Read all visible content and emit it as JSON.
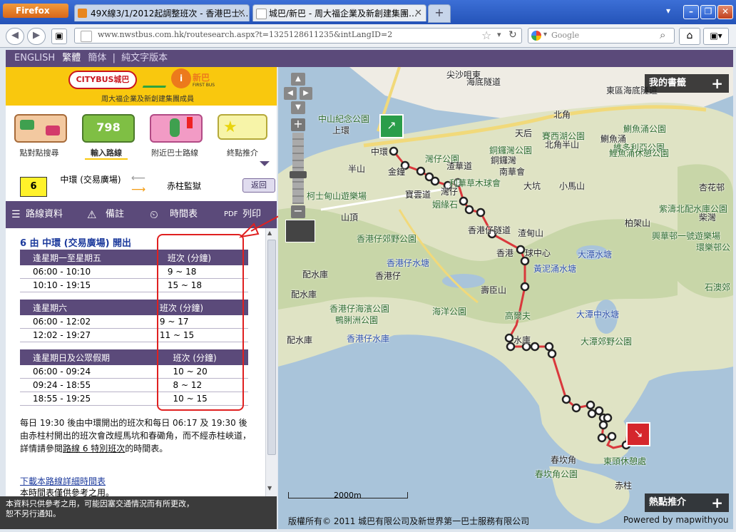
{
  "browser": {
    "app_button": "Firefox",
    "tabs": [
      {
        "title": "49X線3/1/2012起調整班次 - 香港巴士…",
        "active": false
      },
      {
        "title": "城巴/新巴 - 周大福企業及新創建集團…",
        "active": true
      }
    ],
    "new_tab": "+",
    "url": "www.nwstbus.com.hk/routesearch.aspx?t=1325128611235&intLangID=2",
    "search_engine": "Google",
    "search_placeholder": "Google"
  },
  "langbar": {
    "english": "ENGLISH",
    "traditional": "繁體",
    "simplified": "簡体",
    "sep": "|",
    "text_only": "純文字版本"
  },
  "header": {
    "citybus": "CITYBUS城巴",
    "firstbus": "新巴",
    "firstbus_en": "FIRST BUS",
    "tagline": "周大福企業及新創建集團成員"
  },
  "nav_icons": [
    {
      "label": "點對點搜尋"
    },
    {
      "label": "輸入路線"
    },
    {
      "label": "附近巴士路線"
    },
    {
      "label": "終點推介"
    }
  ],
  "route": {
    "number": "6",
    "from": "中環 (交易廣場)",
    "to": "赤柱監獄",
    "back": "返回"
  },
  "subtabs": {
    "info": "路線資料",
    "notes": "備註",
    "timetable": "時間表",
    "print": "列印"
  },
  "schedule": {
    "heading": "6 由 中環 (交易廣場) 開出",
    "freq_header": "班次 (分鐘)",
    "groups": [
      {
        "label": "逢星期一至星期五",
        "rows": [
          [
            "06:00 - 10:10",
            "9 ~ 18"
          ],
          [
            "10:10 - 19:15",
            "15 ~ 18"
          ]
        ]
      },
      {
        "label": "逢星期六",
        "rows": [
          [
            "06:00 - 12:02",
            "9 ~ 17"
          ],
          [
            "12:02 - 19:27",
            "11 ~ 15"
          ]
        ]
      },
      {
        "label": "逢星期日及公眾假期",
        "rows": [
          [
            "06:00 - 09:24",
            "10 ~ 20"
          ],
          [
            "09:24 - 18:55",
            "8 ~ 12"
          ],
          [
            "18:55 - 19:25",
            "10 ~ 15"
          ]
        ]
      }
    ],
    "note_pre": "每日 19:30 後由中環開出的班次和每日 06:17 及 19:30 後由赤柱村開出的班次會改經馬坑和春磡角，而不經赤柱峽道，詳情請參閱",
    "note_link": "路線 6 特別班次",
    "note_post": "的時間表。",
    "download_link": "下載本路線詳細時間表",
    "download_note": "本時間表僅供參考之用。"
  },
  "footer": {
    "line1": "本資料只供參考之用，可能因塞交通情況而有所更改，",
    "line2": "恕不另行通知。"
  },
  "map": {
    "bookmarks": "我的書籤",
    "recommend": "熱點推介",
    "scale": "2000m",
    "copyright": "版權所有© 2011 城巴有限公司及新世界第一巴士服務有限公司",
    "powered": "Powered by mapwithyou",
    "labels": [
      {
        "text": "尖沙咀東",
        "cls": ""
      },
      {
        "text": "海底隧道",
        "cls": ""
      },
      {
        "text": "東區海底隧道",
        "cls": ""
      },
      {
        "text": "北角",
        "cls": ""
      },
      {
        "text": "中山紀念公園",
        "cls": "green"
      },
      {
        "text": "上環",
        "cls": ""
      },
      {
        "text": "天后",
        "cls": ""
      },
      {
        "text": "賽西湖公園",
        "cls": "green"
      },
      {
        "text": "鰂魚涌",
        "cls": ""
      },
      {
        "text": "鰂魚涌公園",
        "cls": "green"
      },
      {
        "text": "北角半山",
        "cls": ""
      },
      {
        "text": "中環",
        "cls": ""
      },
      {
        "text": "維多利亞公園",
        "cls": "green"
      },
      {
        "text": "銅鑼灣公園",
        "cls": "green"
      },
      {
        "text": "鯉魚涌休憩公園",
        "cls": "green"
      },
      {
        "text": "半山",
        "cls": ""
      },
      {
        "text": "金鐘",
        "cls": ""
      },
      {
        "text": "灣仔公園",
        "cls": "green"
      },
      {
        "text": "銅鑼灣",
        "cls": ""
      },
      {
        "text": "南華會",
        "cls": ""
      },
      {
        "text": "渣華道",
        "cls": ""
      },
      {
        "text": "利華草木球會",
        "cls": "green"
      },
      {
        "text": "灣仔",
        "cls": ""
      },
      {
        "text": "寶雲道",
        "cls": ""
      },
      {
        "text": "大坑",
        "cls": ""
      },
      {
        "text": "小馬山",
        "cls": ""
      },
      {
        "text": "柏架山",
        "cls": ""
      },
      {
        "text": "杏花邨",
        "cls": ""
      },
      {
        "text": "柯士甸山遊樂場",
        "cls": "green"
      },
      {
        "text": "姻緣石",
        "cls": "green"
      },
      {
        "text": "紫濤北配水庫公園",
        "cls": "green"
      },
      {
        "text": "柴灣",
        "cls": ""
      },
      {
        "text": "山頂",
        "cls": ""
      },
      {
        "text": "香港仔隧道",
        "cls": ""
      },
      {
        "text": "渣甸山",
        "cls": ""
      },
      {
        "text": "興華邨一號遊樂場",
        "cls": "green"
      },
      {
        "text": "香港仔郊野公園",
        "cls": "green"
      },
      {
        "text": "香港",
        "cls": ""
      },
      {
        "text": "球中心",
        "cls": ""
      },
      {
        "text": "大潭水塘",
        "cls": "blue"
      },
      {
        "text": "環樂邨公",
        "cls": "green"
      },
      {
        "text": "配水庫",
        "cls": ""
      },
      {
        "text": "香港仔水塘",
        "cls": "blue"
      },
      {
        "text": "香港仔",
        "cls": ""
      },
      {
        "text": "黃泥涌水塘",
        "cls": "blue"
      },
      {
        "text": "石澳郊",
        "cls": "green"
      },
      {
        "text": "壽臣山",
        "cls": ""
      },
      {
        "text": "配水庫",
        "cls": ""
      },
      {
        "text": "香港仔海濱公園",
        "cls": "green"
      },
      {
        "text": "海洋公園",
        "cls": "green"
      },
      {
        "text": "高爾夫",
        "cls": "green"
      },
      {
        "text": "大潭中水塘",
        "cls": "blue"
      },
      {
        "text": "鴨脷洲公園",
        "cls": "green"
      },
      {
        "text": "水庫",
        "cls": ""
      },
      {
        "text": "大潭郊野公園",
        "cls": "green"
      },
      {
        "text": "配水庫",
        "cls": ""
      },
      {
        "text": "香港仔水庫",
        "cls": "blue"
      },
      {
        "text": "春坎角",
        "cls": ""
      },
      {
        "text": "春坎角公園",
        "cls": "green"
      },
      {
        "text": "東頭休憩處",
        "cls": "green"
      },
      {
        "text": "赤柱",
        "cls": ""
      }
    ]
  }
}
